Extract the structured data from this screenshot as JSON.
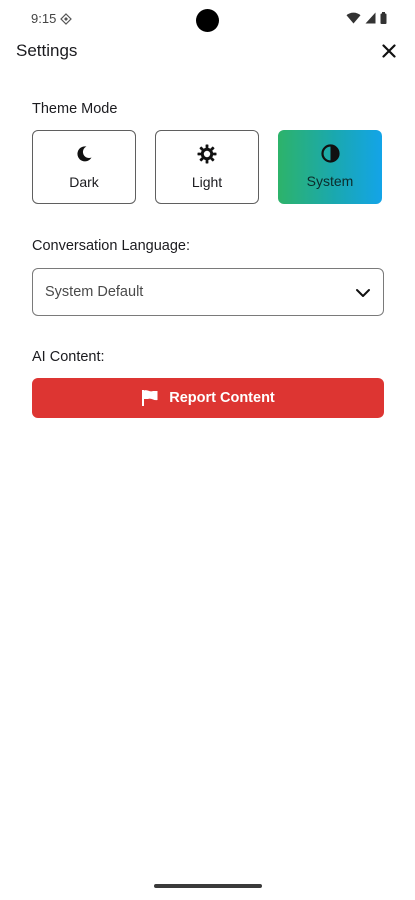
{
  "status_bar": {
    "time": "9:15",
    "icons": [
      "sync-icon",
      "wifi-icon",
      "signal-icon",
      "battery-icon"
    ]
  },
  "header": {
    "title": "Settings",
    "close_icon": "close-icon"
  },
  "theme": {
    "label": "Theme Mode",
    "options": [
      {
        "label": "Dark",
        "icon": "moon-icon",
        "selected": false
      },
      {
        "label": "Light",
        "icon": "sun-icon",
        "selected": false
      },
      {
        "label": "System",
        "icon": "contrast-icon",
        "selected": true
      }
    ],
    "selected_gradient": [
      "#2db36a",
      "#13a4e8"
    ]
  },
  "language": {
    "label": "Conversation Language:",
    "selected_value": "System Default"
  },
  "ai_content": {
    "label": "AI Content:",
    "report_button_label": "Report Content",
    "report_icon": "flag-icon",
    "report_color": "#dd3532"
  }
}
